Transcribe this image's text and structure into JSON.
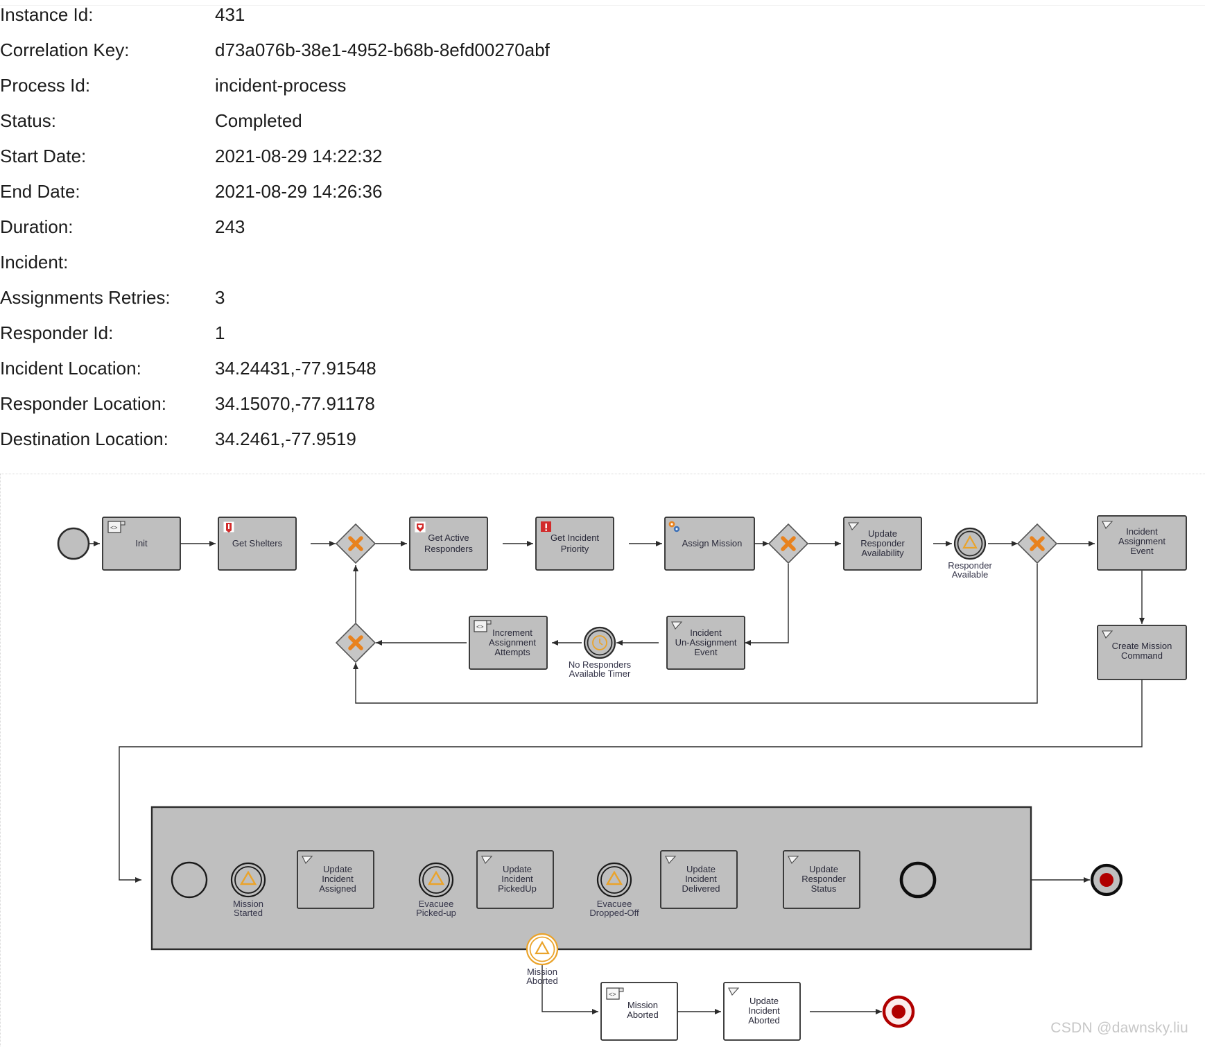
{
  "details": {
    "rows": [
      {
        "label": "Instance Id:",
        "value": "431"
      },
      {
        "label": "Correlation Key:",
        "value": "d73a076b-38e1-4952-b68b-8efd00270abf"
      },
      {
        "label": "Process Id:",
        "value": "incident-process"
      },
      {
        "label": "Status:",
        "value": "Completed"
      },
      {
        "label": "Start Date:",
        "value": "2021-08-29 14:22:32"
      },
      {
        "label": "End Date:",
        "value": "2021-08-29 14:26:36"
      },
      {
        "label": "Duration:",
        "value": "243"
      }
    ],
    "incident_label": "Incident:",
    "incident_rows": [
      {
        "label": "Assignments Retries:",
        "value": "3"
      },
      {
        "label": "Responder Id:",
        "value": "1"
      },
      {
        "label": "Incident Location:",
        "value": "34.24431,-77.91548"
      },
      {
        "label": "Responder Location:",
        "value": "34.15070,-77.91178"
      },
      {
        "label": "Destination Location:",
        "value": "34.2461,-77.9519"
      }
    ]
  },
  "diagram": {
    "colors": {
      "task_fill": "#bfbfbf",
      "task_stroke": "#2b2b2b",
      "white_fill": "#ffffff",
      "gateway_x": "#e8821e",
      "event_amber": "#eaa32a",
      "end_red": "#b00000",
      "line": "#2b2b2b",
      "subprocess_fill": "#bfbfbf"
    },
    "tasks": [
      {
        "id": "init",
        "label": "Init",
        "icon": "script-icon",
        "lines": [
          "Init"
        ]
      },
      {
        "id": "get-shelters",
        "label": "Get Shelters",
        "icon": "db-service-icon",
        "lines": [
          "Get Shelters"
        ]
      },
      {
        "id": "get-active-responders",
        "label": "Get Active Responders",
        "icon": "service-heart-icon",
        "lines": [
          "Get Active",
          "Responders"
        ]
      },
      {
        "id": "get-incident-priority",
        "label": "Get Incident Priority",
        "icon": "priority-icon",
        "lines": [
          "Get Incident",
          "Priority"
        ]
      },
      {
        "id": "assign-mission",
        "label": "Assign Mission",
        "icon": "gear-service-icon",
        "lines": [
          "Assign Mission"
        ]
      },
      {
        "id": "update-responder-availability",
        "label": "Update Responder Availability",
        "icon": "send-task-icon",
        "lines": [
          "Update",
          "Responder",
          "Availability"
        ]
      },
      {
        "id": "incident-assignment-event",
        "label": "Incident Assignment Event",
        "icon": "send-task-icon",
        "lines": [
          "Incident",
          "Assignment",
          "Event"
        ]
      },
      {
        "id": "create-mission-command",
        "label": "Create Mission Command",
        "icon": "send-task-icon",
        "lines": [
          "Create Mission",
          "Command"
        ]
      },
      {
        "id": "increment-assignment-attempts",
        "label": "Increment Assignment Attempts",
        "icon": "script-icon",
        "lines": [
          "Increment",
          "Assignment",
          "Attempts"
        ]
      },
      {
        "id": "incident-un-assignment-event",
        "label": "Incident Un-Assignment Event",
        "icon": "send-task-icon",
        "lines": [
          "Incident",
          "Un-Assignment",
          "Event"
        ]
      },
      {
        "id": "update-incident-assigned",
        "label": "Update Incident Assigned",
        "icon": "send-task-icon",
        "lines": [
          "Update",
          "Incident",
          "Assigned"
        ]
      },
      {
        "id": "update-incident-pickedup",
        "label": "Update Incident PickedUp",
        "icon": "send-task-icon",
        "lines": [
          "Update",
          "Incident",
          "PickedUp"
        ]
      },
      {
        "id": "update-incident-delivered",
        "label": "Update Incident Delivered",
        "icon": "send-task-icon",
        "lines": [
          "Update",
          "Incident",
          "Delivered"
        ]
      },
      {
        "id": "update-responder-status",
        "label": "Update Responder Status",
        "icon": "send-task-icon",
        "lines": [
          "Update",
          "Responder",
          "Status"
        ]
      },
      {
        "id": "mission-aborted-task",
        "label": "Mission Aborted",
        "icon": "script-icon",
        "lines": [
          "Mission",
          "Aborted"
        ]
      },
      {
        "id": "update-incident-aborted",
        "label": "Update Incident Aborted",
        "icon": "send-task-icon",
        "lines": [
          "Update",
          "Incident",
          "Aborted"
        ]
      }
    ],
    "events": [
      {
        "id": "start-event",
        "type": "start",
        "label": ""
      },
      {
        "id": "responder-available",
        "type": "intermediate-signal",
        "lines": [
          "Responder",
          "Available"
        ]
      },
      {
        "id": "no-responders-available-timer",
        "type": "intermediate-timer",
        "lines": [
          "No Responders",
          "Available Timer"
        ]
      },
      {
        "id": "sub-start-event",
        "type": "start-plain",
        "label": ""
      },
      {
        "id": "mission-started",
        "type": "intermediate-signal",
        "lines": [
          "Mission",
          "Started"
        ]
      },
      {
        "id": "evacuee-picked-up",
        "type": "intermediate-signal",
        "lines": [
          "Evacuee",
          "Picked-up"
        ]
      },
      {
        "id": "evacuee-dropped-off",
        "type": "intermediate-signal",
        "lines": [
          "Evacuee",
          "Dropped-Off"
        ]
      },
      {
        "id": "sub-end-event",
        "type": "end-plain",
        "label": ""
      },
      {
        "id": "mission-aborted-boundary",
        "type": "boundary-signal",
        "lines": [
          "Mission",
          "Aborted"
        ]
      },
      {
        "id": "main-end-event",
        "type": "end-terminate",
        "label": ""
      },
      {
        "id": "abort-end-event",
        "type": "end-terminate",
        "label": ""
      }
    ],
    "gateways": [
      {
        "id": "gateway-retry-join",
        "type": "exclusive"
      },
      {
        "id": "gateway-responders-found",
        "type": "exclusive"
      },
      {
        "id": "gateway-responder-available",
        "type": "exclusive"
      },
      {
        "id": "gateway-loop-merge",
        "type": "exclusive"
      }
    ]
  },
  "watermark": "CSDN @dawnsky.liu"
}
